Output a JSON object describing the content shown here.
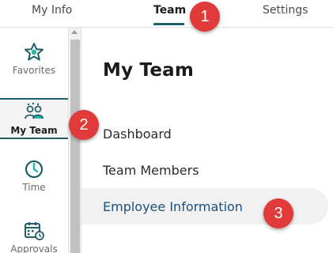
{
  "tabs": [
    {
      "label": "My Info",
      "active": false
    },
    {
      "label": "Team",
      "active": true
    },
    {
      "label": "Settings",
      "active": false
    }
  ],
  "rail": {
    "items": [
      {
        "label": "Favorites",
        "icon": "star-icon",
        "active": false
      },
      {
        "label": "My Team",
        "icon": "team-icon",
        "active": true
      },
      {
        "label": "Time",
        "icon": "clock-icon",
        "active": false
      },
      {
        "label": "Approvals",
        "icon": "calendar-clock-icon",
        "active": false
      }
    ]
  },
  "panel": {
    "title": "My Team",
    "links": [
      {
        "label": "Dashboard"
      },
      {
        "label": "Team Members"
      },
      {
        "label": "Employee Information",
        "highlighted": true
      }
    ]
  },
  "callouts": [
    "1",
    "2",
    "3"
  ],
  "colors": {
    "accent": "#1f5f66",
    "link": "#1e4f7a",
    "callout": "#e03a3a",
    "highlight_row": "#f1f1f1"
  }
}
